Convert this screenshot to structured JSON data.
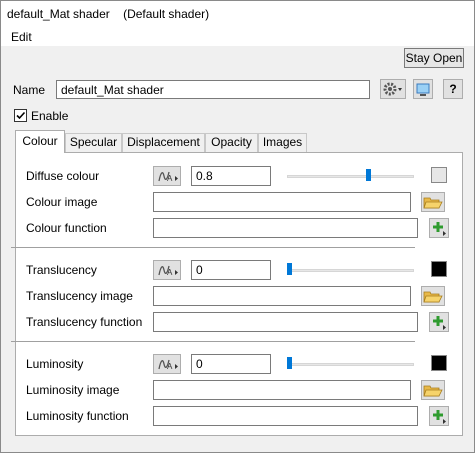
{
  "window": {
    "title": "default_Mat shader    (Default shader)",
    "menu": [
      "Edit"
    ],
    "stay_open_label": "Stay Open"
  },
  "header": {
    "name_label": "Name",
    "name_value": "default_Mat shader",
    "enable_label": "Enable",
    "enable_checked": true,
    "help_label": "?"
  },
  "tabs": [
    "Colour",
    "Specular",
    "Displacement",
    "Opacity",
    "Images"
  ],
  "active_tab": "Colour",
  "colour": {
    "diffuse_label": "Diffuse colour",
    "diffuse_value": "0.8",
    "diffuse_slider": 0.8,
    "diffuse_swatch": "#e6e6e6",
    "image_label": "Colour image",
    "image_value": "",
    "function_label": "Colour function",
    "function_value": ""
  },
  "translucency": {
    "label": "Translucency",
    "value": "0",
    "slider": 0,
    "swatch": "#000000",
    "image_label": "Translucency image",
    "image_value": "",
    "function_label": "Translucency function",
    "function_value": ""
  },
  "luminosity": {
    "label": "Luminosity",
    "value": "0",
    "slider": 0,
    "swatch": "#000000",
    "image_label": "Luminosity image",
    "image_value": "",
    "function_label": "Luminosity function",
    "function_value": ""
  }
}
